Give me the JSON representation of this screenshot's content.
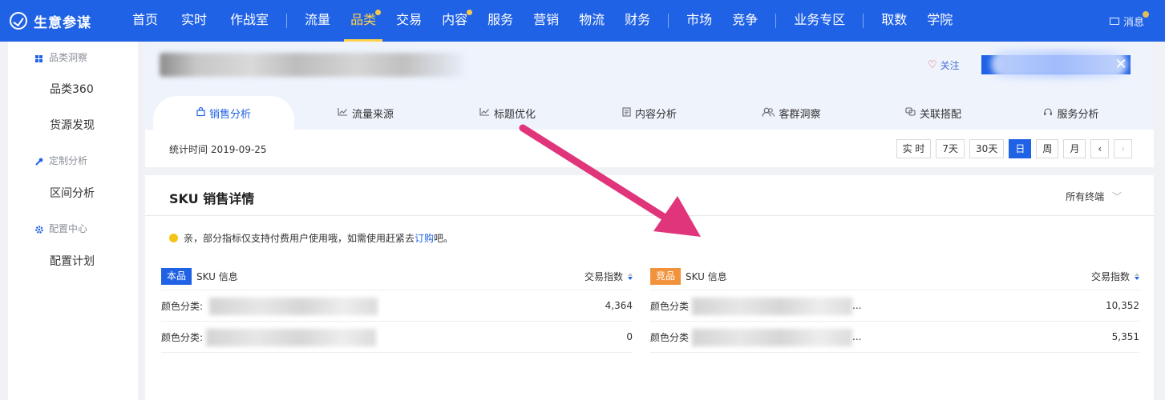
{
  "brand": {
    "name": "生意参谋"
  },
  "nav": {
    "items": [
      {
        "label": "首页"
      },
      {
        "label": "实时"
      },
      {
        "label": "作战室"
      },
      {
        "label": "流量"
      },
      {
        "label": "品类"
      },
      {
        "label": "交易"
      },
      {
        "label": "内容"
      },
      {
        "label": "服务"
      },
      {
        "label": "营销"
      },
      {
        "label": "物流"
      },
      {
        "label": "财务"
      },
      {
        "label": "市场"
      },
      {
        "label": "竞争"
      },
      {
        "label": "业务专区"
      },
      {
        "label": "取数"
      },
      {
        "label": "学院"
      }
    ],
    "active": "品类",
    "message": "消息"
  },
  "sidebar": {
    "group1": "品类洞察",
    "item1": "品类360",
    "item2": "货源发现",
    "group2": "定制分析",
    "item3": "区间分析",
    "group3": "配置中心",
    "item4": "配置计划"
  },
  "header": {
    "follow": "关注",
    "tabs": [
      {
        "label": "销售分析",
        "icon": "bag-icon"
      },
      {
        "label": "流量来源",
        "icon": "trend-icon"
      },
      {
        "label": "标题优化",
        "icon": "trend-icon"
      },
      {
        "label": "内容分析",
        "icon": "doc-icon"
      },
      {
        "label": "客群洞察",
        "icon": "users-icon"
      },
      {
        "label": "关联搭配",
        "icon": "link-icon"
      },
      {
        "label": "服务分析",
        "icon": "headset-icon"
      }
    ],
    "stat_time": "统计时间 2019-09-25",
    "periods": [
      "实 时",
      "7天",
      "30天",
      "日",
      "周",
      "月"
    ],
    "active_period": "日"
  },
  "sku": {
    "title": "SKU 销售详情",
    "terminal": "所有终端",
    "notice_prefix": "亲，部分指标仅支持付费用户使用哦，如需使用赶紧去 ",
    "notice_link": "订购",
    "notice_suffix": "吧。",
    "left": {
      "tag": "本品",
      "label": "SKU 信息",
      "metric": "交易指数",
      "rows": [
        {
          "label": "颜色分类:",
          "value": "4,364"
        },
        {
          "label": "颜色分类:",
          "value": "0"
        }
      ]
    },
    "right": {
      "tag": "竞品",
      "label": "SKU 信息",
      "metric": "交易指数",
      "rows": [
        {
          "label": "颜色分类",
          "tail": "...",
          "value": "10,352"
        },
        {
          "label": "颜色分类",
          "tail": "...",
          "value": "5,351"
        }
      ]
    }
  },
  "colors": {
    "nav_bg": "#2062e6",
    "active_nav": "#ffd24a",
    "arrow": "#e0357a",
    "competitor_tag": "#f2923a"
  }
}
